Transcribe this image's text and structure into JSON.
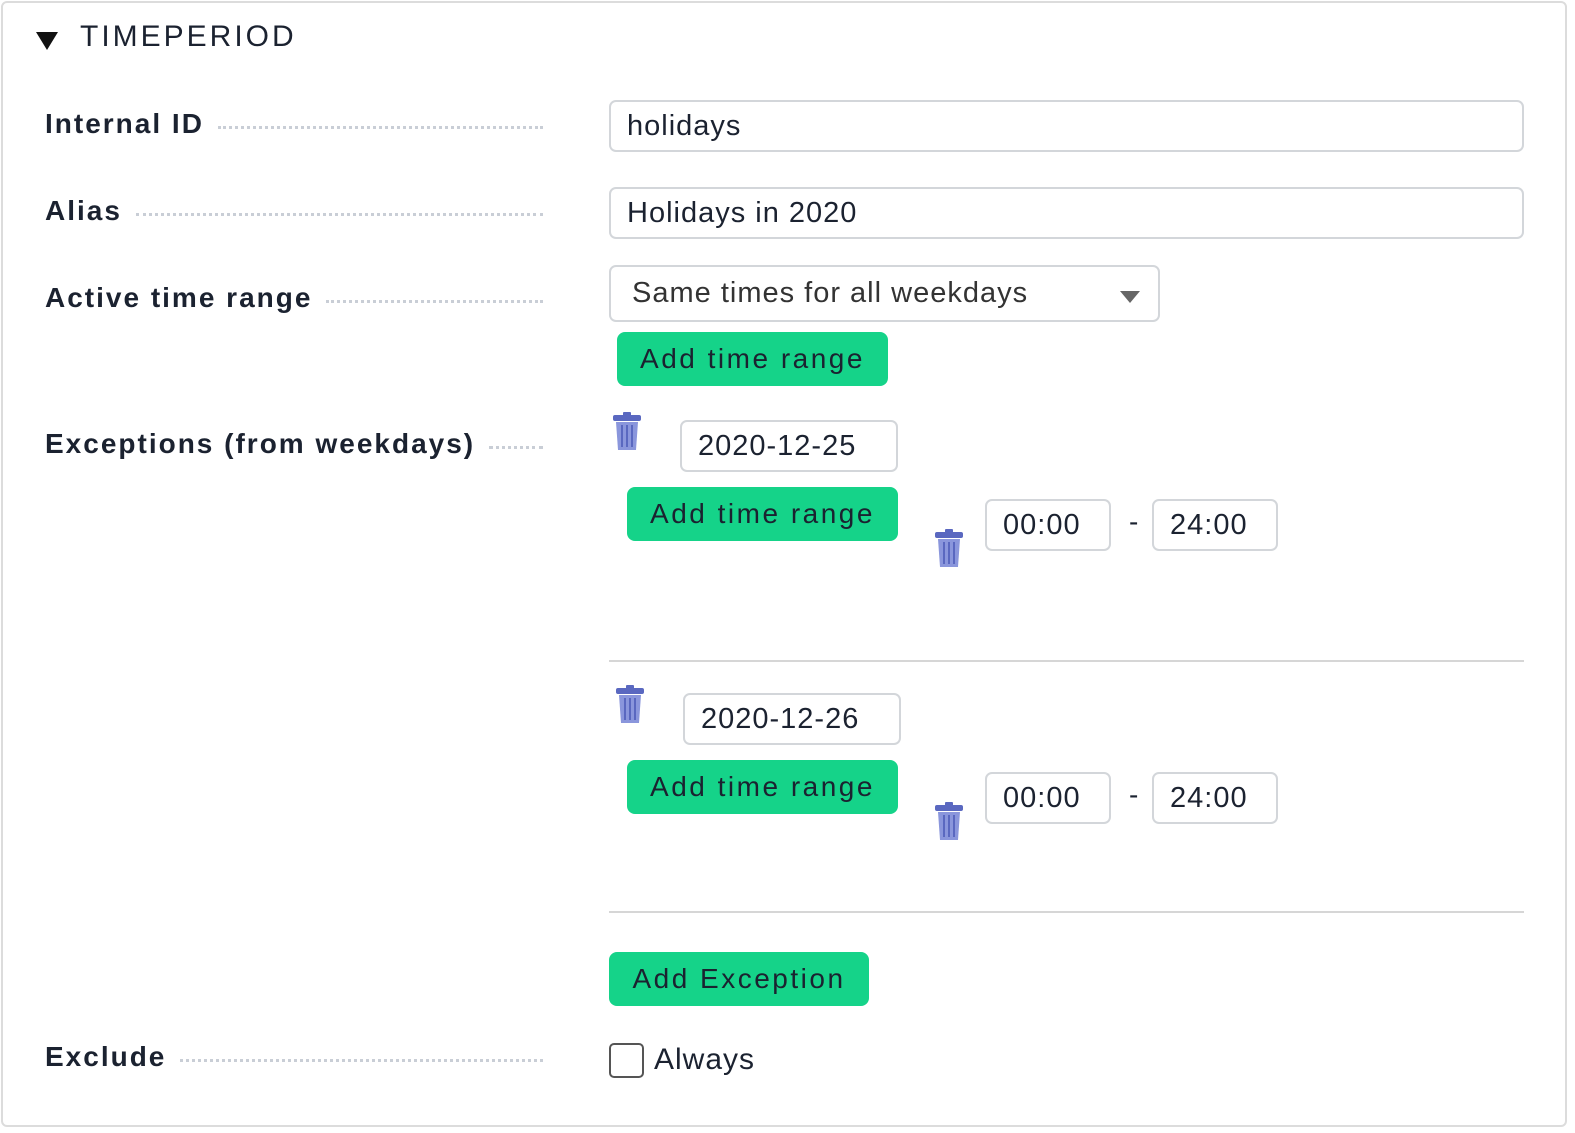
{
  "section": {
    "title": "TIMEPERIOD"
  },
  "fields": {
    "internal_id": {
      "label": "Internal ID",
      "value": "holidays"
    },
    "alias": {
      "label": "Alias",
      "value": "Holidays in 2020"
    },
    "active_time_range": {
      "label": "Active time range",
      "selected": "Same times for all weekdays",
      "add_button": "Add time range"
    },
    "exceptions": {
      "label": "Exceptions (from weekdays)",
      "items": [
        {
          "date": "2020-12-25",
          "add_button": "Add time range",
          "from": "00:00",
          "to": "24:00",
          "separator": "-"
        },
        {
          "date": "2020-12-26",
          "add_button": "Add time range",
          "from": "00:00",
          "to": "24:00",
          "separator": "-"
        }
      ],
      "add_exception_button": "Add Exception"
    },
    "exclude": {
      "label": "Exclude",
      "checkbox_label": "Always",
      "checked": false
    }
  },
  "colors": {
    "button_green": "#15d389",
    "trash_blue": "#6f7fd0",
    "border": "#d3d6da"
  }
}
